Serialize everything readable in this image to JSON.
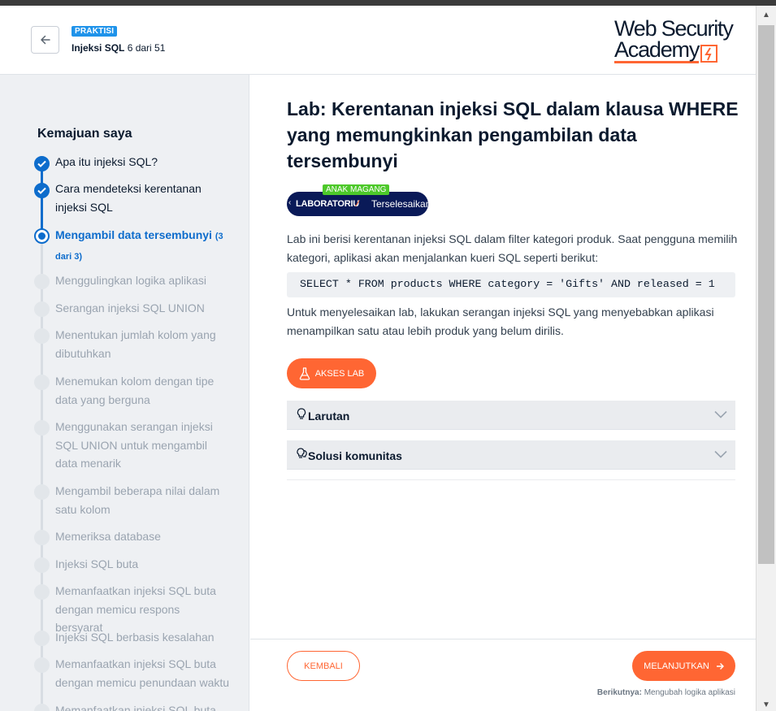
{
  "header": {
    "badge": "PRAKTISI",
    "module_name": "Injeksi SQL",
    "module_progress": "6 dari 51",
    "logo_line1": "Web Security",
    "logo_line2": "Academy"
  },
  "sidebar": {
    "title": "Kemajuan saya",
    "steps": [
      {
        "label": "Apa itu injeksi SQL?",
        "state": "done"
      },
      {
        "label": "Cara mendeteksi kerentanan injeksi SQL",
        "state": "done"
      },
      {
        "label": "Mengambil data tersembunyi",
        "suffix": "(3 dari 3)",
        "state": "current"
      },
      {
        "label": "Menggulingkan logika aplikasi",
        "state": "todo"
      },
      {
        "label": "Serangan injeksi SQL UNION",
        "state": "todo"
      },
      {
        "label": "Menentukan jumlah kolom yang dibutuhkan",
        "state": "todo"
      },
      {
        "label": "Menemukan kolom dengan tipe data yang berguna",
        "state": "todo"
      },
      {
        "label": "Menggunakan serangan injeksi SQL UNION untuk mengambil data menarik",
        "state": "todo"
      },
      {
        "label": "Mengambil beberapa nilai dalam satu kolom",
        "state": "todo"
      },
      {
        "label": "Memeriksa database",
        "state": "todo"
      },
      {
        "label": "Injeksi SQL buta",
        "state": "todo"
      },
      {
        "label": "Memanfaatkan injeksi SQL buta dengan memicu respons bersyarat",
        "state": "todo"
      },
      {
        "label": "Injeksi SQL berbasis kesalahan",
        "state": "todo"
      },
      {
        "label": "Memanfaatkan injeksi SQL buta dengan memicu penundaan waktu",
        "state": "todo"
      },
      {
        "label": "Memanfaatkan injeksi SQL buta",
        "state": "todo"
      }
    ]
  },
  "main": {
    "title": "Lab: Kerentanan injeksi SQL dalam klausa WHERE yang memungkinkan pengambilan data tersembunyi",
    "level_tag": "ANAK MAGANG",
    "lab_label": "LABORATORIU",
    "lab_status": "Terselesaikan",
    "intro": "Lab ini berisi kerentanan injeksi SQL dalam filter kategori produk. Saat pengguna memilih kategori, aplikasi akan menjalankan kueri SQL seperti berikut:",
    "code": "SELECT * FROM products WHERE category = 'Gifts' AND released = 1",
    "goal": "Untuk menyelesaikan lab, lakukan serangan injeksi SQL yang menyebabkan aplikasi menampilkan satu atau lebih produk yang belum dirilis.",
    "access_button": "AKSES LAB",
    "accordion": [
      {
        "label": "Larutan",
        "icon": "lightbulb-icon"
      },
      {
        "label": "Solusi komunitas",
        "icon": "lightbulbs-icon"
      }
    ]
  },
  "footer": {
    "back_button": "KEMBALI",
    "next_button": "MELANJUTKAN",
    "next_prefix": "Berikutnya:",
    "next_topic": "Mengubah logika aplikasi"
  },
  "colors": {
    "accent": "#ff6633",
    "progress_blue": "#0d6ccc",
    "badge_blue": "#1f93ea",
    "badge_green": "#4dc92a",
    "lab_navy": "#0a1a58"
  }
}
